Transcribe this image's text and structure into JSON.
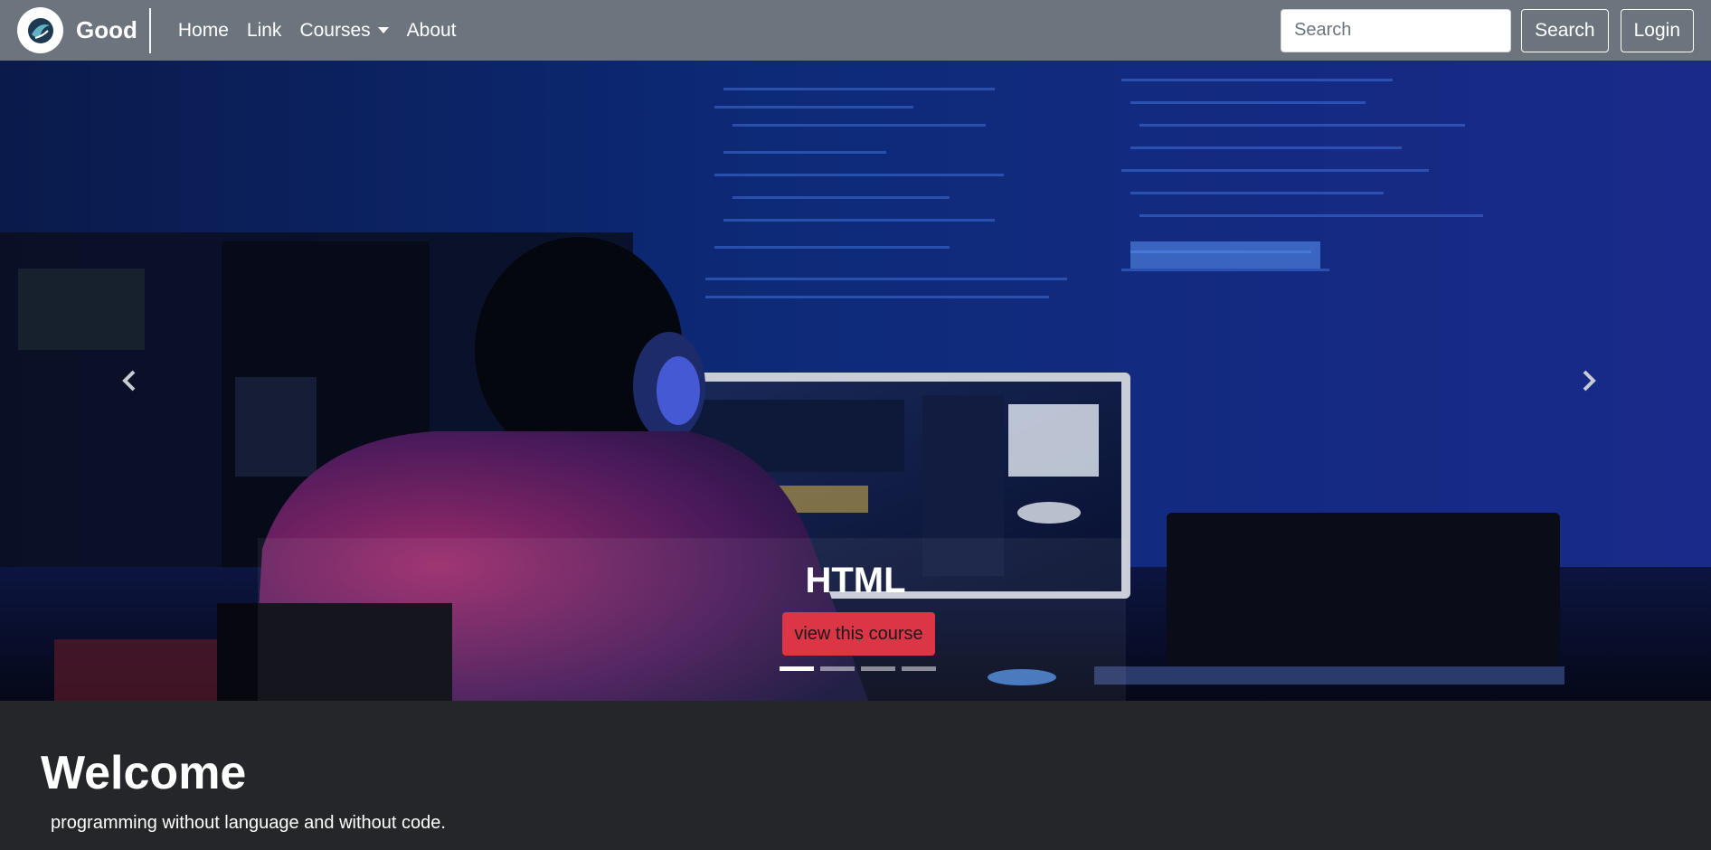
{
  "navbar": {
    "brand": "Good",
    "links": [
      {
        "label": "Home"
      },
      {
        "label": "Link"
      },
      {
        "label": "Courses"
      },
      {
        "label": "About"
      }
    ],
    "search": {
      "placeholder": "Search",
      "value": ""
    },
    "search_button": "Search",
    "login_button": "Login",
    "background_color": "#6c757d"
  },
  "carousel": {
    "slide_title": "HTML",
    "cta_label": "view this course",
    "cta_color": "#dc3545",
    "slide_count": 4,
    "active_index": 0,
    "prev_icon": "chevron-left-icon",
    "next_icon": "chevron-right-icon"
  },
  "welcome": {
    "title": "Welcome",
    "text": "programming without language and without code."
  }
}
